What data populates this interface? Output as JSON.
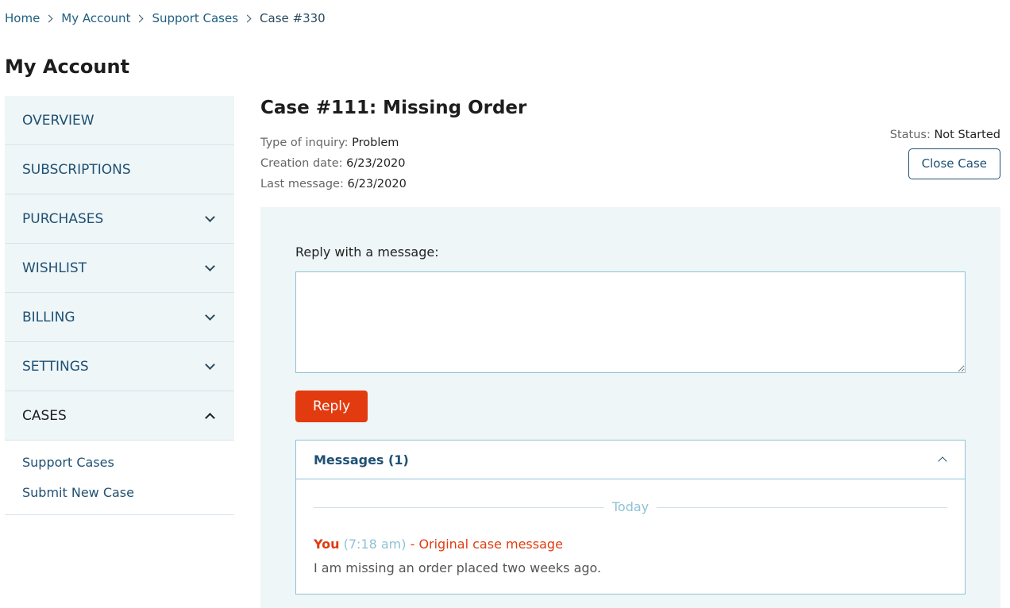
{
  "breadcrumb": [
    "Home",
    "My Account",
    "Support Cases",
    "Case #330"
  ],
  "page_title": "My Account",
  "sidebar": {
    "items": [
      {
        "label": "OVERVIEW",
        "chevron": "none"
      },
      {
        "label": "SUBSCRIPTIONS",
        "chevron": "none"
      },
      {
        "label": "PURCHASES",
        "chevron": "down"
      },
      {
        "label": "WISHLIST",
        "chevron": "down"
      },
      {
        "label": "BILLING",
        "chevron": "down"
      },
      {
        "label": "SETTINGS",
        "chevron": "down"
      },
      {
        "label": "CASES",
        "chevron": "up",
        "active": true
      }
    ],
    "sub_items": [
      "Support Cases",
      "Submit New Case"
    ]
  },
  "case": {
    "title": "Case #111: Missing Order",
    "type_label": "Type of inquiry:",
    "type_value": "Problem",
    "created_label": "Creation date:",
    "created_value": "6/23/2020",
    "last_label": "Last message:",
    "last_value": "6/23/2020",
    "status_label": "Status:",
    "status_value": "Not Started",
    "close_button": "Close Case"
  },
  "reply": {
    "label": "Reply with a message:",
    "value": "",
    "button": "Reply"
  },
  "messages": {
    "header": "Messages (1)",
    "divider": "Today",
    "items": [
      {
        "author": "You",
        "time": "(7:18 am)",
        "note": "- Original case message",
        "body": "I am missing an order placed two weeks ago."
      }
    ]
  },
  "colors": {
    "accent": "#e23b0f",
    "link": "#1f5073",
    "panel_bg": "#eef6f8",
    "border": "#8fc2d6"
  }
}
